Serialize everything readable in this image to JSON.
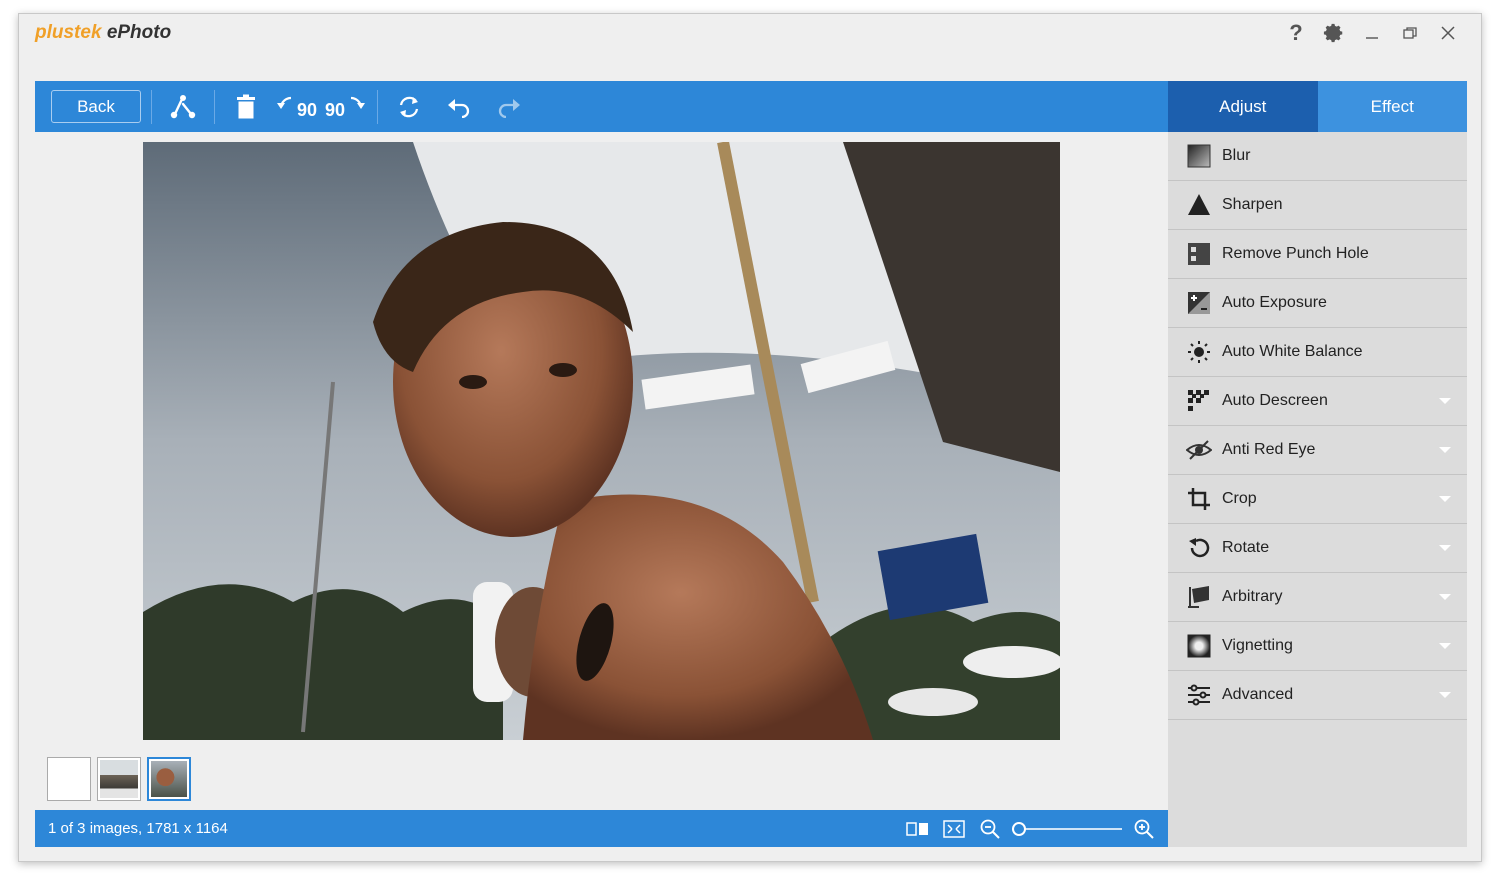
{
  "app": {
    "brand": "plustek",
    "product": "ePhoto"
  },
  "window_controls": {
    "help": "?",
    "settings": "gear-icon",
    "minimize": "minimize-icon",
    "restore": "restore-icon",
    "close": "close-icon"
  },
  "toolbar": {
    "back_label": "Back",
    "rotate_left_label": "90",
    "rotate_right_label": "90"
  },
  "tabs": [
    {
      "label": "Adjust",
      "active": true
    },
    {
      "label": "Effect",
      "active": false
    }
  ],
  "adjust_items": [
    {
      "label": "Blur",
      "icon": "blur-icon",
      "has_dropdown": false
    },
    {
      "label": "Sharpen",
      "icon": "sharpen-icon",
      "has_dropdown": false
    },
    {
      "label": "Remove Punch Hole",
      "icon": "punch-hole-icon",
      "has_dropdown": false
    },
    {
      "label": "Auto Exposure",
      "icon": "exposure-icon",
      "has_dropdown": false
    },
    {
      "label": "Auto White Balance",
      "icon": "white-balance-icon",
      "has_dropdown": false
    },
    {
      "label": "Auto Descreen",
      "icon": "descreen-icon",
      "has_dropdown": true
    },
    {
      "label": "Anti Red Eye",
      "icon": "red-eye-icon",
      "has_dropdown": true
    },
    {
      "label": "Crop",
      "icon": "crop-icon",
      "has_dropdown": true
    },
    {
      "label": "Rotate",
      "icon": "rotate-icon",
      "has_dropdown": true
    },
    {
      "label": "Arbitrary",
      "icon": "arbitrary-icon",
      "has_dropdown": true
    },
    {
      "label": "Vignetting",
      "icon": "vignetting-icon",
      "has_dropdown": true
    },
    {
      "label": "Advanced",
      "icon": "advanced-icon",
      "has_dropdown": true
    }
  ],
  "status": {
    "text": "1 of 3 images, 1781 x 1164"
  },
  "thumbnails": [
    {
      "selected": false
    },
    {
      "selected": false
    },
    {
      "selected": true
    }
  ],
  "colors": {
    "accent": "#2d87d8",
    "tab_active": "#1c5fae",
    "brand_orange": "#f0a028"
  }
}
